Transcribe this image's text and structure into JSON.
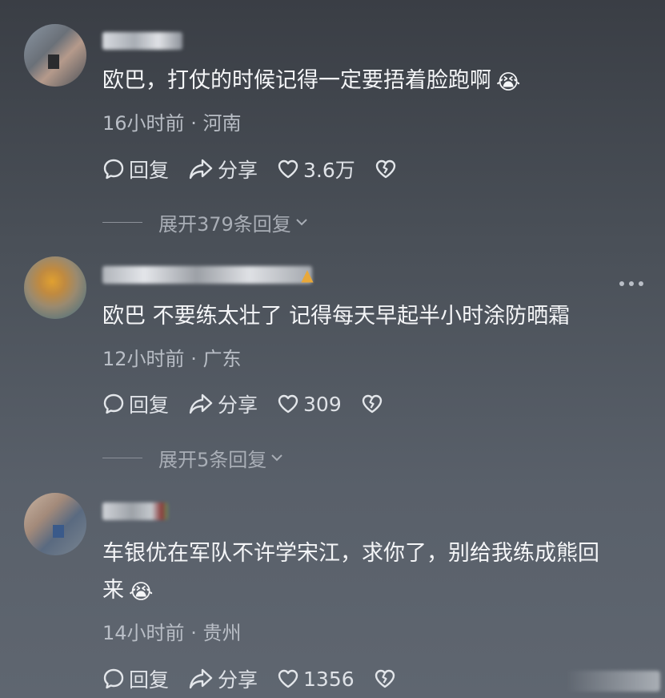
{
  "comments": [
    {
      "text": "欧巴，打仗的时候记得一定要捂着脸跑啊",
      "emoji": "😭",
      "time": "16小时前",
      "location": "河南",
      "reply_label": "回复",
      "share_label": "分享",
      "likes": "3.6万",
      "expand": "展开379条回复"
    },
    {
      "text": "欧巴 不要练太壮了 记得每天早起半小时涂防晒霜",
      "emoji": "",
      "time": "12小时前",
      "location": "广东",
      "reply_label": "回复",
      "share_label": "分享",
      "likes": "309",
      "expand": "展开5条回复"
    },
    {
      "text_line1": "车银优在军队不许学宋江，求你了，别给我练成熊回",
      "text_line2": "来",
      "emoji": "😭",
      "time": "14小时前",
      "location": "贵州",
      "reply_label": "回复",
      "share_label": "分享",
      "likes": "1356"
    }
  ],
  "separator": "·",
  "colors": {
    "badge": "#e8a83a"
  }
}
